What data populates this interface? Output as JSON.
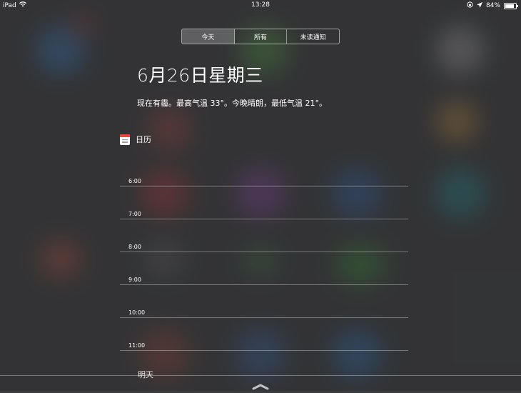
{
  "status_bar": {
    "device": "iPad",
    "time": "13:28",
    "battery_percent": "84%",
    "battery_level": 0.84
  },
  "tabs": [
    {
      "label": "今天",
      "active": true
    },
    {
      "label": "所有",
      "active": false
    },
    {
      "label": "未读通知",
      "active": false
    }
  ],
  "today": {
    "date": "6月26日星期三",
    "weather": "现在有霾。最高气温 33°。今晚晴朗，最低气温 21°。"
  },
  "calendar": {
    "title": "日历",
    "hours": [
      "6:00",
      "7:00",
      "8:00",
      "9:00",
      "10:00",
      "11:00"
    ]
  },
  "tomorrow_label": "明天",
  "icons": {
    "wifi": "wifi-icon",
    "location": "location-arrow-icon",
    "rotation_lock": "rotation-lock-icon",
    "battery": "battery-icon",
    "calendar": "calendar-icon",
    "close_handle": "chevron-up-icon"
  },
  "colors": {
    "accent_red": "#e34b3c",
    "overlay": "#3a3b3d"
  }
}
